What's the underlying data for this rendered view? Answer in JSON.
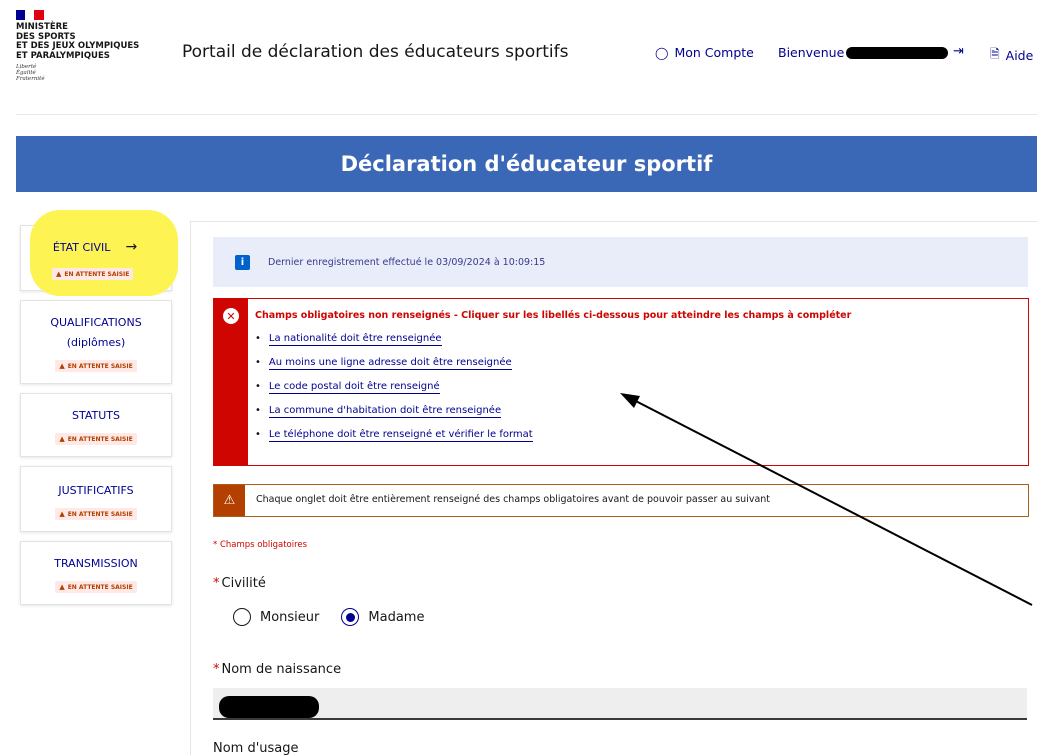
{
  "header": {
    "ministry_lines": [
      "MINISTÈRE",
      "DES SPORTS",
      "ET DES JEUX OLYMPIQUES",
      "ET PARALYMPIQUES"
    ],
    "motto_lines": [
      "Liberté",
      "Égalité",
      "Fraternité"
    ],
    "portal_title": "Portail de déclaration des éducateurs sportifs",
    "account_link": "Mon Compte",
    "welcome_label": "Bienvenue",
    "help_link": "Aide"
  },
  "banner": {
    "title": "Déclaration d'éducateur sportif"
  },
  "sidebar": {
    "items": [
      {
        "label": "ÉTAT CIVIL",
        "badge": "EN ATTENTE SAISIE"
      },
      {
        "label_line1": "QUALIFICATIONS",
        "label_line2": "(diplômes)",
        "badge": "EN ATTENTE SAISIE"
      },
      {
        "label": "STATUTS",
        "badge": "EN ATTENTE SAISIE"
      },
      {
        "label": "JUSTIFICATIFS",
        "badge": "EN ATTENTE SAISIE"
      },
      {
        "label": "TRANSMISSION",
        "badge": "EN ATTENTE SAISIE"
      }
    ]
  },
  "info": {
    "text": "Dernier enregistrement effectué le 03/09/2024 à 10:09:15"
  },
  "errors": {
    "title": "Champs obligatoires non renseignés - Cliquer sur les libellés ci-dessous pour atteindre les champs à compléter",
    "items": [
      "La nationalité doit être renseignée",
      "Au moins une ligne adresse doit être renseignée",
      "Le code postal doit être renseigné",
      "La commune d'habitation doit être renseignée",
      "Le téléphone doit être renseigné et vérifier le format"
    ]
  },
  "warning": {
    "text": "Chaque onglet doit être entièrement renseigné des champs obligatoires avant de pouvoir passer au suivant"
  },
  "form": {
    "required_note": "* Champs obligatoires",
    "civility_label": "Civilité",
    "options": [
      "Monsieur",
      "Madame"
    ],
    "selected": "Madame",
    "birth_name_label": "Nom de naissance",
    "usage_name_label": "Nom d'usage"
  },
  "colors": {
    "banner": "#3b68b6",
    "link": "#000091",
    "error": "#ce0500",
    "warning": "#b34000",
    "highlight": "#fdf24a"
  }
}
